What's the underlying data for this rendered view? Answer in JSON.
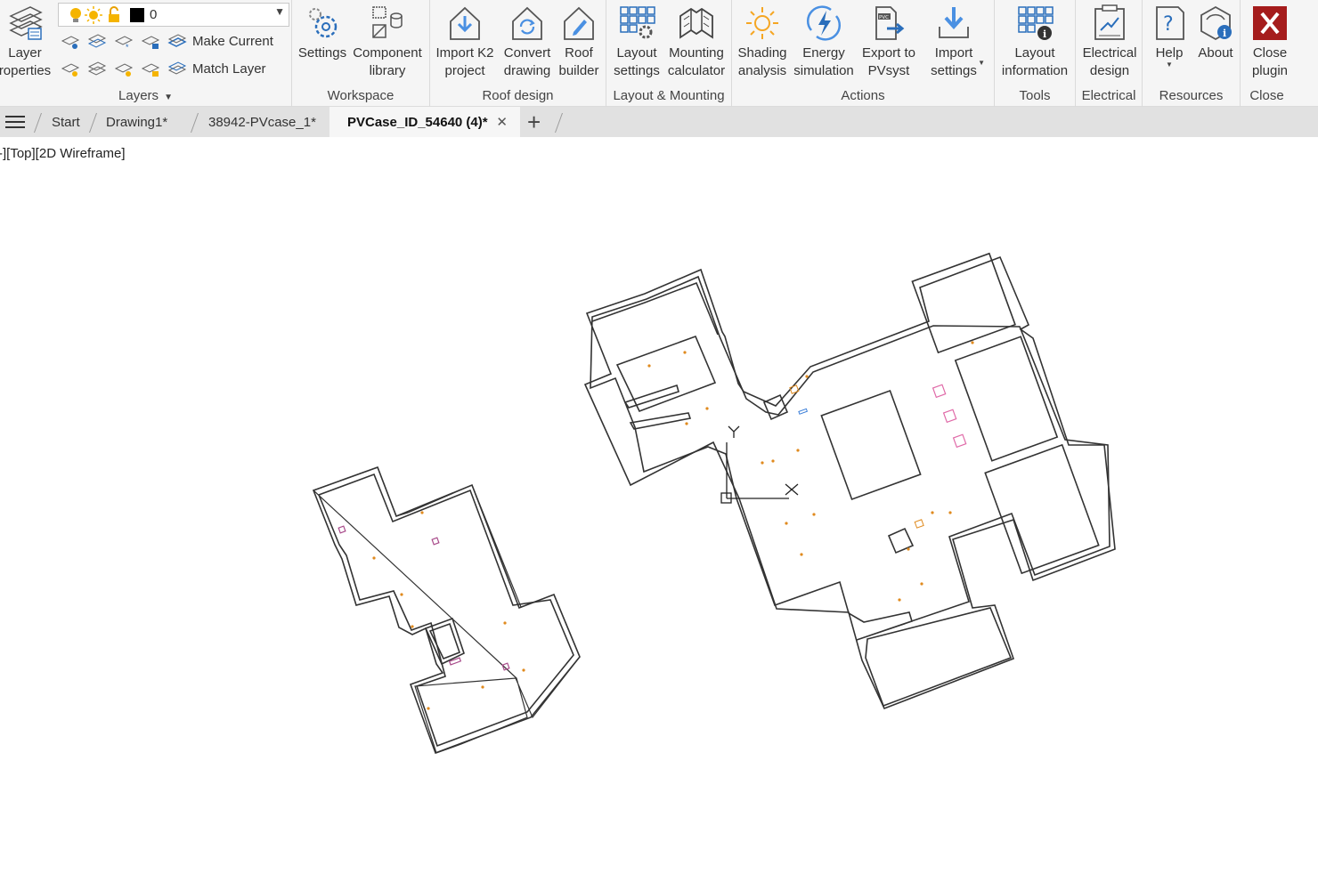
{
  "ribbon": {
    "layers": {
      "layer_properties_label": "Layer\nroperties",
      "current_layer": "0",
      "make_current_label": "Make Current",
      "match_layer_label": "Match Layer",
      "panel_title": "Layers"
    },
    "workspace": {
      "settings_label": "Settings",
      "component_library_label": "Component\nlibrary",
      "panel_title": "Workspace"
    },
    "roof_design": {
      "import_k2_label": "Import K2\nproject",
      "convert_drawing_label": "Convert\ndrawing",
      "roof_builder_label": "Roof\nbuilder",
      "panel_title": "Roof design"
    },
    "layout_mounting": {
      "layout_settings_label": "Layout\nsettings",
      "mounting_calculator_label": "Mounting\ncalculator",
      "panel_title": "Layout & Mounting"
    },
    "actions": {
      "shading_analysis_label": "Shading\nanalysis",
      "energy_simulation_label": "Energy\nsimulation",
      "export_pvsyst_label": "Export to\nPVsyst",
      "import_settings_label": "Import\nsettings",
      "panel_title": "Actions"
    },
    "tools": {
      "layout_information_label": "Layout\ninformation",
      "panel_title": "Tools"
    },
    "electrical": {
      "electrical_design_label": "Electrical\ndesign",
      "panel_title": "Electrical"
    },
    "resources": {
      "help_label": "Help",
      "about_label": "About",
      "panel_title": "Resources"
    },
    "close": {
      "close_plugin_label": "Close\nplugin",
      "panel_title": "Close"
    }
  },
  "tabs": {
    "items": [
      "Start",
      "Drawing1*",
      "38942-PVcase_1*",
      "PVCase_ID_54640 (4)*"
    ],
    "active_index": 3,
    "close_glyph": "✕",
    "add_glyph": "+"
  },
  "viewport": {
    "view_label": "-][Top][2D Wireframe]",
    "ucs_x_label": "X",
    "ucs_y_label": "Y"
  },
  "colors": {
    "ribbon_bg": "#f5f5f5",
    "tabbar_bg": "#e1e1e1",
    "outline": "#333333",
    "marker_orange": "#e08a1e",
    "marker_pink": "#e06aa8",
    "marker_magenta": "#a84a8a",
    "marker_blue": "#3c7fd8",
    "close_red": "#a51c1c"
  }
}
